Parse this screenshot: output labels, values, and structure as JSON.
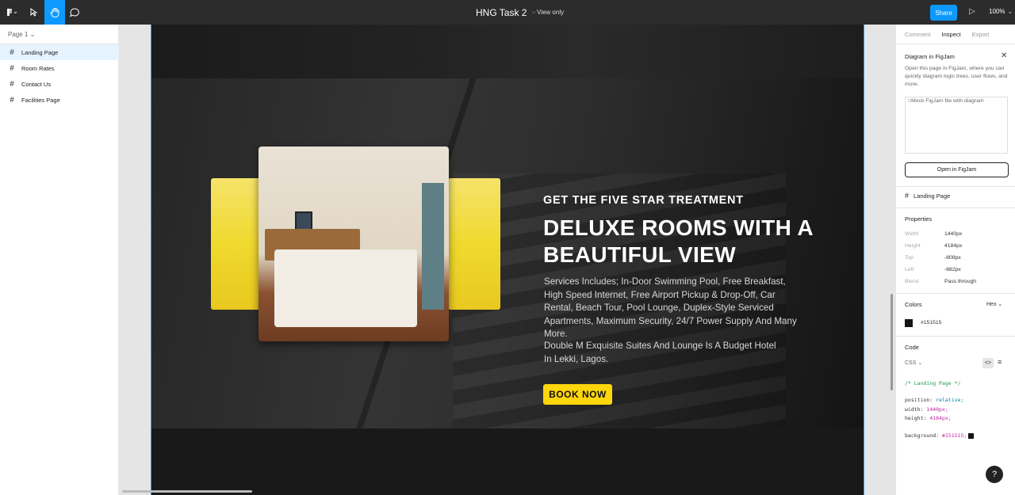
{
  "toolbar": {
    "file_title": "HNG Task 2",
    "view_mode": "View only",
    "share_label": "Share",
    "zoom": "100%",
    "icons": [
      "figma-menu-icon",
      "move-tool-icon",
      "hand-tool-icon",
      "comment-icon",
      "play-icon"
    ],
    "accent": "#0d99ff"
  },
  "layers": {
    "page_selector": "Page 1",
    "items": [
      {
        "label": "Landing Page",
        "selected": true
      },
      {
        "label": "Room Rates",
        "selected": false
      },
      {
        "label": "Contact Us",
        "selected": false
      },
      {
        "label": "Facilities Page",
        "selected": false
      }
    ]
  },
  "hero": {
    "eyebrow": "GET THE FIVE STAR TREATMENT",
    "headline": "DELUXE ROOMS WITH A BEAUTIFUL VIEW",
    "description": "Services Includes; In-Door Swimming Pool, Free Breakfast, High Speed Internet, Free Airport Pickup & Drop-Off, Car Rental, Beach Tour, Pool Lounge, Duplex-Style Serviced Apartments, Maximum Security, 24/7 Power Supply And Many More.",
    "location": "Double M Exquisite Suites And Lounge Is A Budget Hotel In Lekki, Lagos.",
    "cta": "BOOK NOW",
    "cta_color": "#ffd60a",
    "carousel_active_index": 0,
    "carousel_count": 3
  },
  "inspect": {
    "tabs": [
      "Comment",
      "Inspect",
      "Export"
    ],
    "active_tab": "Inspect",
    "figjam": {
      "title": "Diagram in FigJam",
      "description": "Open this page in FigJam, where you can quickly diagram logic trees, user flows, and more.",
      "image_alt": "Mock FigJam file with diagram",
      "button": "Open in FigJam"
    },
    "frame_name": "Landing Page",
    "properties_title": "Properties",
    "properties": [
      {
        "key": "Width",
        "value": "1440px"
      },
      {
        "key": "Height",
        "value": "4184px"
      },
      {
        "key": "Top",
        "value": "-808px"
      },
      {
        "key": "Left",
        "value": "-682px"
      },
      {
        "key": "Blend",
        "value": "Pass through"
      }
    ],
    "colors_title": "Colors",
    "color_format": "Hex",
    "color_value": "#151515",
    "code_title": "Code",
    "code_lang": "CSS",
    "code": {
      "comment": "/* Landing Page */",
      "position_key": "position:",
      "position_val": "relative;",
      "width_key": "width:",
      "width_val": "1440px;",
      "height_key": "height:",
      "height_val": "4184px;",
      "background_key": "background:",
      "background_val": "#151515;"
    }
  },
  "help_label": "?"
}
